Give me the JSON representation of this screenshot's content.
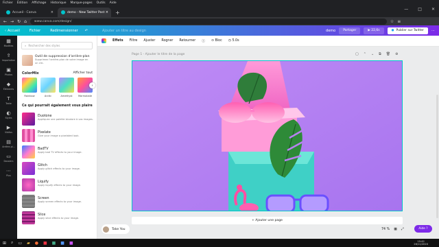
{
  "menubar": [
    "Fichier",
    "Édition",
    "Affichage",
    "Historique",
    "Marque-pages",
    "Outils",
    "Aide"
  ],
  "tabs": [
    {
      "label": "Accueil - Canva"
    },
    {
      "label": "demo - New Twitter Post"
    }
  ],
  "address": {
    "url": "www.canva.com/design/"
  },
  "topbar": {
    "home": "Accueil",
    "file": "Fichier",
    "resize": "Redimensionner",
    "title_placeholder": "Ajouter un titre au design",
    "design_name": "demo",
    "share": "Partager",
    "play_count": "22,6s",
    "publish": "Publier sur Twitter"
  },
  "sidebar": [
    {
      "label": "Modèles",
      "icon": "template-icon"
    },
    {
      "label": "Importation",
      "icon": "upload-icon"
    },
    {
      "label": "Photos",
      "icon": "photo-icon"
    },
    {
      "label": "Éléments",
      "icon": "shapes-icon"
    },
    {
      "label": "Texte",
      "icon": "text-icon"
    },
    {
      "label": "Styles",
      "icon": "palette-icon"
    },
    {
      "label": "Vidéos",
      "icon": "video-icon"
    },
    {
      "label": "Arrière-pl...",
      "icon": "background-icon"
    },
    {
      "label": "Dossiers",
      "icon": "folder-icon"
    },
    {
      "label": "Plus",
      "icon": "more-icon"
    }
  ],
  "panel": {
    "search_placeholder": "Rechercher des styles",
    "feature": {
      "title": "Outil de suppression d'arrière-plan",
      "desc": "Supprimez l'arrière-plan de votre image en un clic."
    },
    "colormix": {
      "title": "ColorMix",
      "see_all": "Afficher tout",
      "items": [
        "Rainbow",
        "Arctic",
        "Amethyst",
        "Marmalade"
      ]
    },
    "suggest_title": "Ce qui pourrait également vous plaire",
    "effects": [
      {
        "name": "Duotone",
        "desc": "Appliquez une palette bicolore à vos images."
      },
      {
        "name": "Pixelate",
        "desc": "Give your image a pixelated look."
      },
      {
        "name": "BadTV",
        "desc": "Apply bad TV effects to your image."
      },
      {
        "name": "Glitch",
        "desc": "Apply glitch effects to your image."
      },
      {
        "name": "Liquify",
        "desc": "Apply liquify effects to your image."
      },
      {
        "name": "Screen",
        "desc": "Apply screen effects to your image."
      },
      {
        "name": "Slice",
        "desc": "Apply slice effects to your image."
      }
    ]
  },
  "toolbar": {
    "effects": "Effets",
    "filter": "Filtre",
    "adjust": "Ajuster",
    "crop": "Rogner",
    "flip": "Retourner",
    "lock": "Bloc",
    "duration": "5.0s"
  },
  "canvas": {
    "page_title": "Page 1 - Ajouter le titre de la page",
    "add_page": "+ Ajouter une page"
  },
  "bottom": {
    "user": "Take You",
    "zoom": "74 %",
    "help": "Aide ?"
  },
  "clock": {
    "time": "15:42",
    "date": "26/11/2020"
  },
  "colors": {
    "accent": "#7d2ae8",
    "teal": "#00c4cc",
    "page_bg": "#b781f0"
  }
}
